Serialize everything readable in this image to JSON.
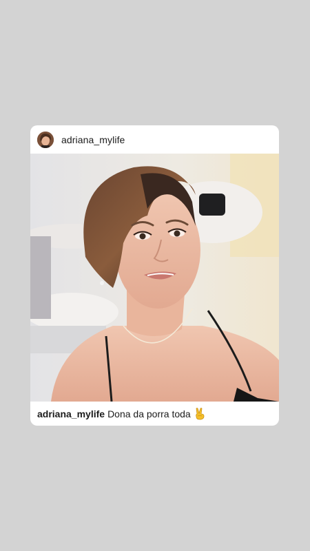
{
  "post": {
    "username": "adriana_mylife",
    "caption": {
      "username": "adriana_mylife",
      "text": "Dona da porra toda",
      "emoji": "victory-hand-emoji"
    },
    "avatar_icon": "profile-avatar",
    "photo_subject": "portrait-photo"
  },
  "colors": {
    "background": "#d3d3d3",
    "card": "#ffffff",
    "text": "#1b1b1b",
    "emoji": "#f5c02a"
  }
}
